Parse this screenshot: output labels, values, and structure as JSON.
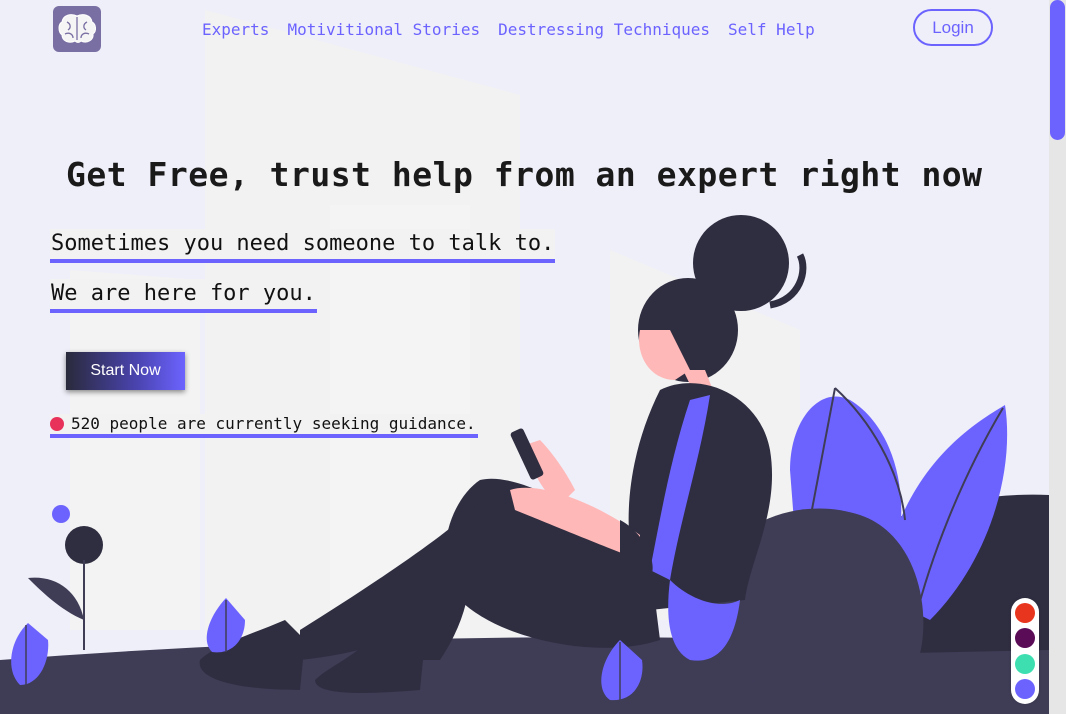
{
  "nav": {
    "links": [
      "Experts",
      "Motivitional Stories",
      "Destressing Techniques",
      "Self Help"
    ],
    "login_label": "Login",
    "logo_icon": "brain-icon"
  },
  "hero": {
    "headline": "Get Free, trust help from an expert right now",
    "line1": "Sometimes you need someone to talk to.",
    "line2": "We are here for you.",
    "cta_label": "Start Now",
    "status_text": "520 people are currently seeking guidance."
  },
  "theme_swatches": [
    "#e8361e",
    "#5a0c57",
    "#3ddfb0",
    "#6c63ff"
  ],
  "colors": {
    "accent": "#6c63ff",
    "dark": "#2f2e41",
    "status_dot": "#e8325a"
  }
}
